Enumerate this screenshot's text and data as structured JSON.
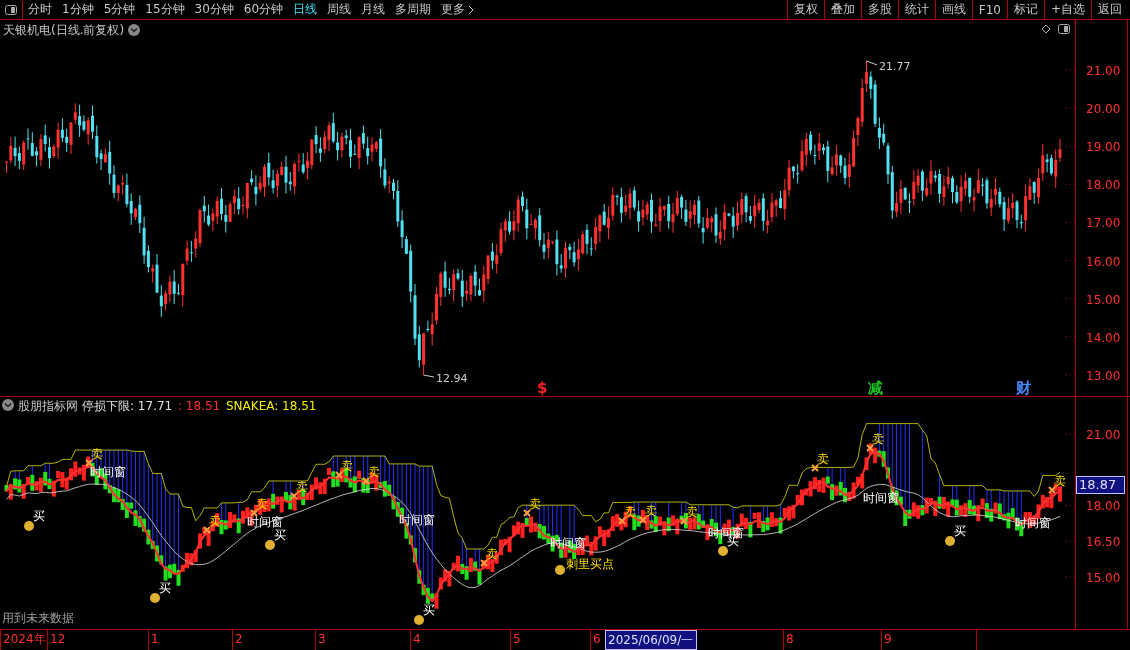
{
  "toolbar": {
    "periods": [
      {
        "label": "分时",
        "selected": false
      },
      {
        "label": "1分钟",
        "selected": false
      },
      {
        "label": "5分钟",
        "selected": false
      },
      {
        "label": "15分钟",
        "selected": false
      },
      {
        "label": "30分钟",
        "selected": false
      },
      {
        "label": "60分钟",
        "selected": false
      },
      {
        "label": "日线",
        "selected": true
      },
      {
        "label": "周线",
        "selected": false
      },
      {
        "label": "月线",
        "selected": false
      },
      {
        "label": "多周期",
        "selected": false
      },
      {
        "label": "更多",
        "selected": false
      }
    ],
    "actions": [
      "复权",
      "叠加",
      "多股",
      "统计",
      "画线",
      "F10",
      "标记",
      "+自选",
      "返回"
    ]
  },
  "main_chart": {
    "title": "天银机电(日线.前复权)",
    "y_axis": [
      "21.00",
      "20.00",
      "19.00",
      "18.00",
      "17.00",
      "16.00",
      "15.00",
      "14.00",
      "13.00"
    ],
    "high_label": "21.77",
    "low_label": "12.94",
    "event_marks": [
      {
        "text": "$",
        "color": "#ff2020"
      },
      {
        "text": "减",
        "color": "#20c020"
      },
      {
        "text": "财",
        "color": "#4a8cff"
      }
    ]
  },
  "indicator_panel": {
    "name": "股朋指标网",
    "stop_label": "停损下限: 17.71",
    "stop_value": ": 18.51",
    "snake_label": "SNAKEA: 18.51",
    "y_axis": [
      "21.00",
      "18.00",
      "16.50",
      "15.00"
    ],
    "current_price": "18.87",
    "signals": [
      {
        "kind": "sell",
        "text": "卖"
      },
      {
        "kind": "sell",
        "text": "卖"
      },
      {
        "kind": "sell",
        "text": "卖"
      },
      {
        "kind": "sell",
        "text": "卖"
      },
      {
        "kind": "sell",
        "text": "卖"
      },
      {
        "kind": "sell",
        "text": "卖"
      },
      {
        "kind": "sell",
        "text": "卖"
      },
      {
        "kind": "sell",
        "text": "卖"
      },
      {
        "kind": "sell",
        "text": "卖"
      },
      {
        "kind": "sell",
        "text": "卖"
      },
      {
        "kind": "sell",
        "text": "卖"
      },
      {
        "kind": "sell",
        "text": "卖"
      },
      {
        "kind": "sell",
        "text": "卖"
      },
      {
        "kind": "sell",
        "text": "卖"
      },
      {
        "kind": "buy",
        "text": "买"
      },
      {
        "kind": "buy",
        "text": "买"
      },
      {
        "kind": "buy",
        "text": "买"
      },
      {
        "kind": "buy",
        "text": "买"
      },
      {
        "kind": "buy",
        "text": "买"
      },
      {
        "kind": "buy",
        "text": "买"
      },
      {
        "kind": "window",
        "text": "时间窗"
      },
      {
        "kind": "window",
        "text": "时间窗"
      },
      {
        "kind": "window",
        "text": "时间窗"
      },
      {
        "kind": "window",
        "text": "时间窗"
      },
      {
        "kind": "window",
        "text": "时间窗"
      },
      {
        "kind": "window",
        "text": "时间窗"
      },
      {
        "kind": "window",
        "text": "时间窗"
      },
      {
        "kind": "special",
        "text": "刺里买点"
      }
    ],
    "note": "用到未来数据"
  },
  "time_axis": {
    "labels": [
      {
        "text": "2024年",
        "selected": false
      },
      {
        "text": "12",
        "selected": false
      },
      {
        "text": "1",
        "selected": false
      },
      {
        "text": "2",
        "selected": false
      },
      {
        "text": "3",
        "selected": false
      },
      {
        "text": "4",
        "selected": false
      },
      {
        "text": "5",
        "selected": false
      },
      {
        "text": "6",
        "selected": false
      },
      {
        "text": "2025/06/09/一",
        "selected": true
      },
      {
        "text": "8",
        "selected": false
      },
      {
        "text": "9",
        "selected": false
      }
    ]
  }
}
